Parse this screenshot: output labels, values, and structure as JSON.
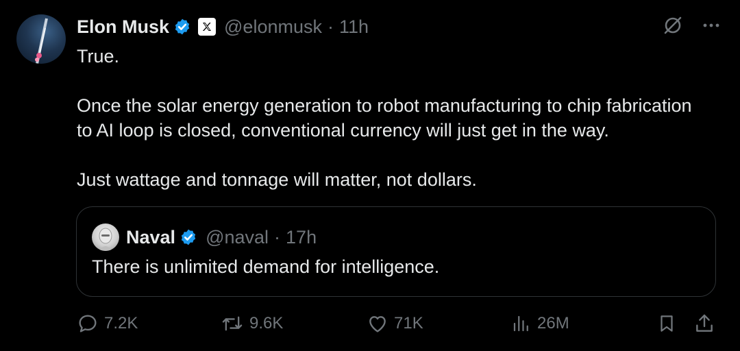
{
  "author": {
    "name": "Elon Musk",
    "handle": "@elonmusk",
    "separator": "·",
    "time": "11h"
  },
  "tweet": {
    "lines": [
      "True.",
      "Once the solar energy generation to robot manufacturing to chip fabrication",
      "to AI loop is closed, conventional currency will just get in the way.",
      "Just wattage and tonnage will matter, not dollars."
    ]
  },
  "quoted": {
    "name": "Naval",
    "handle": "@naval",
    "separator": "·",
    "time": "17h",
    "text": "There is unlimited demand for intelligence."
  },
  "stats": {
    "replies": "7.2K",
    "reposts": "9.6K",
    "likes": "71K",
    "views": "26M"
  },
  "icons": {
    "verified": "verified-badge-icon",
    "x_logo": "x-logo-icon",
    "grok": "grok-icon",
    "more": "more-icon",
    "reply": "reply-icon",
    "repost": "repost-icon",
    "like": "like-icon",
    "views": "views-icon",
    "bookmark": "bookmark-icon",
    "share": "share-icon"
  },
  "colors": {
    "background": "#000000",
    "text": "#e7e9ea",
    "muted": "#71767b",
    "verified": "#1d9bf0",
    "border": "#2f3336"
  }
}
